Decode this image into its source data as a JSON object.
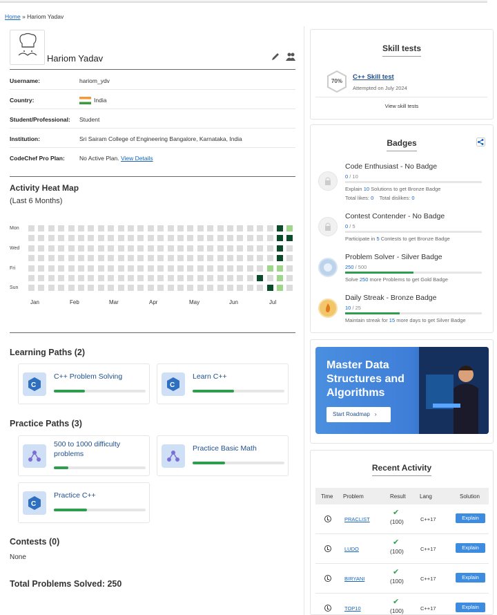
{
  "breadcrumb": {
    "home": "Home",
    "sep": "»",
    "current": "Hariom Yadav"
  },
  "profile": {
    "name": "Hariom Yadav",
    "fields": [
      {
        "key": "Username:",
        "value": "hariom_ydv"
      },
      {
        "key": "Country:",
        "value": "India"
      },
      {
        "key": "Student/Professional:",
        "value": "Student"
      },
      {
        "key": "Institution:",
        "value": "Sri Sairam College of Engineering Bangalore, Karnataka, India"
      },
      {
        "key": "CodeChef Pro Plan:",
        "value": "No Active Plan.",
        "link": "View Details"
      }
    ]
  },
  "heatmap": {
    "title": "Activity Heat Map",
    "subtitle": "(Last 6 Months)",
    "days": [
      "Mon",
      "Wed",
      "Fri",
      "Sun"
    ],
    "months": [
      "Jan",
      "Feb",
      "Mar",
      "Apr",
      "May",
      "Jun",
      "Jul"
    ],
    "active": [
      {
        "week": 25,
        "day": 0,
        "level": 3
      },
      {
        "week": 26,
        "day": 0,
        "level": 1
      },
      {
        "week": 25,
        "day": 1,
        "level": 3
      },
      {
        "week": 26,
        "day": 1,
        "level": 3
      },
      {
        "week": 25,
        "day": 2,
        "level": 3
      },
      {
        "week": 25,
        "day": 3,
        "level": 3
      },
      {
        "week": 24,
        "day": 4,
        "level": 1
      },
      {
        "week": 25,
        "day": 4,
        "level": 1
      },
      {
        "week": 23,
        "day": 5,
        "level": 3
      },
      {
        "week": 25,
        "day": 5,
        "level": 1
      },
      {
        "week": 24,
        "day": 6,
        "level": 3
      },
      {
        "week": 25,
        "day": 6,
        "level": 1
      }
    ]
  },
  "learning": {
    "title": "Learning Paths (2)",
    "items": [
      {
        "label": "C++ Problem Solving",
        "progress": 0.34
      },
      {
        "label": "Learn C++",
        "progress": 0.45
      }
    ]
  },
  "practice": {
    "title": "Practice Paths (3)",
    "items": [
      {
        "label": "500 to 1000 difficulty problems",
        "progress": 0.16
      },
      {
        "label": "Practice Basic Math",
        "progress": 0.35
      },
      {
        "label": "Practice C++",
        "progress": 0.36
      }
    ]
  },
  "contests": {
    "title": "Contests (0)",
    "value": "None"
  },
  "total": {
    "title": "Total Problems Solved: 250"
  },
  "skill": {
    "title": "Skill tests",
    "percent": "70%",
    "name": "C++ Skill test",
    "date": "Attempted on July 2024",
    "link": "View skill tests"
  },
  "badges": {
    "title": "Badges",
    "items": [
      {
        "title": "Code Enthusiast - No Badge",
        "cur": "0",
        "max": "/ 10",
        "progress": 0,
        "d1": "Explain",
        "d2": "10",
        "d3": "Solutions to get Bronze Badge",
        "likes_label": "Total likes:",
        "likes": "0",
        "dislikes_label": "Total dislikes:",
        "dislikes": "0"
      },
      {
        "title": "Contest Contender - No Badge",
        "cur": "0",
        "max": "/ 5",
        "progress": 0,
        "d1": "Participate in",
        "d2": "5",
        "d3": "Contests to get Bronze Badge"
      },
      {
        "title": "Problem Solver - Silver Badge",
        "cur": "250",
        "max": "/ 500",
        "progress": 0.5,
        "d1": "Solve",
        "d2": "250",
        "d3": "more Problems to get Gold Badge"
      },
      {
        "title": "Daily Streak - Bronze Badge",
        "cur": "10",
        "max": "/ 25",
        "progress": 0.4,
        "d1": "Maintain streak for",
        "d2": "15",
        "d3": "more days to get Silver Badge"
      }
    ]
  },
  "banner": {
    "line1": "Master Data",
    "line2": "Structures and",
    "line3": "Algorithms",
    "cta": "Start Roadmap"
  },
  "recent": {
    "title": "Recent Activity",
    "headers": [
      "Time",
      "Problem",
      "Result",
      "Lang",
      "Solution"
    ],
    "rows": [
      {
        "problem": "PRACLIST",
        "result": "(100)",
        "lang": "C++17",
        "btn": "Explain"
      },
      {
        "problem": "LUDO",
        "result": "(100)",
        "lang": "C++17",
        "btn": "Explain"
      },
      {
        "problem": "BIRYANI",
        "result": "(100)",
        "lang": "C++17",
        "btn": "Explain"
      },
      {
        "problem": "TOP10",
        "result": "(100)",
        "lang": "C++17",
        "btn": "Explain"
      }
    ]
  },
  "colors": {
    "accent": "#1565c0",
    "green": "#2e9e4e",
    "heat_dark": "#0b4d2b",
    "heat_light": "#9fd68b",
    "cell": "#dcdcdc"
  }
}
